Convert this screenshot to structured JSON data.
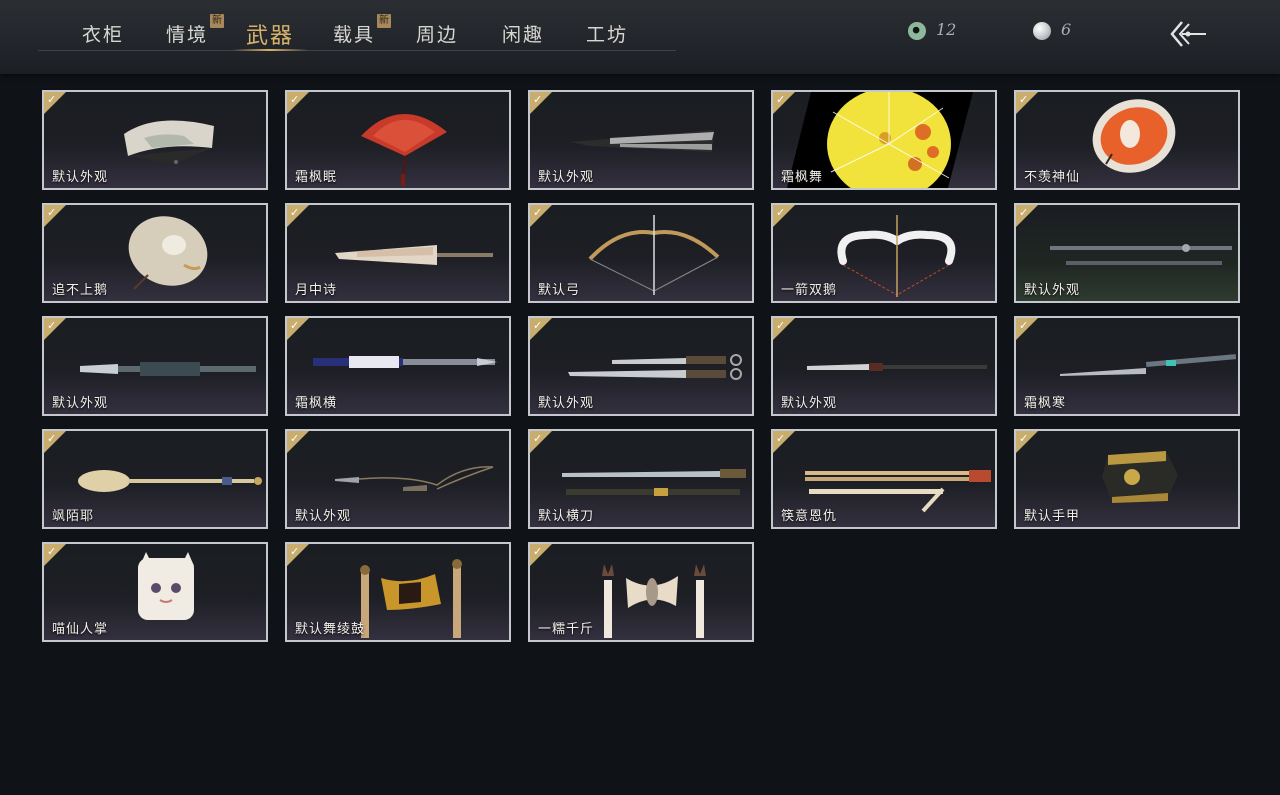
{
  "tabs": [
    {
      "label": "衣柜",
      "new": false
    },
    {
      "label": "情境",
      "new": true
    },
    {
      "label": "武器",
      "new": false,
      "active": true
    },
    {
      "label": "载具",
      "new": true
    },
    {
      "label": "周边",
      "new": false
    },
    {
      "label": "闲趣",
      "new": false
    },
    {
      "label": "工坊",
      "new": false
    }
  ],
  "new_badge": "新",
  "currencies": {
    "jade": {
      "icon": "jade-coin-icon",
      "amount": "12"
    },
    "pearl": {
      "icon": "pearl-icon",
      "amount": "6"
    }
  },
  "back_icon": "back-arrow-icon",
  "check_glyph": "✓",
  "items": [
    {
      "label": "默认外观",
      "icon": "folding-fan-icon"
    },
    {
      "label": "霜枫眠",
      "icon": "red-fan-icon"
    },
    {
      "label": "默认外观",
      "icon": "closed-fan-icon"
    },
    {
      "label": "霜枫舞",
      "icon": "yellow-umbrella-icon"
    },
    {
      "label": "不羡神仙",
      "icon": "orange-umbrella-icon"
    },
    {
      "label": "追不上鹅",
      "icon": "goose-umbrella-icon"
    },
    {
      "label": "月中诗",
      "icon": "closed-umbrella-icon"
    },
    {
      "label": "默认弓",
      "icon": "bow-icon"
    },
    {
      "label": "一箭双鹅",
      "icon": "goose-bow-icon"
    },
    {
      "label": "默认外观",
      "icon": "twin-spear-icon"
    },
    {
      "label": "默认外观",
      "icon": "lance-icon"
    },
    {
      "label": "霜枫横",
      "icon": "blue-lance-icon"
    },
    {
      "label": "默认外观",
      "icon": "twin-sword-icon"
    },
    {
      "label": "默认外观",
      "icon": "glaive-icon"
    },
    {
      "label": "霜枫寒",
      "icon": "jade-glaive-icon"
    },
    {
      "label": "飒陌耶",
      "icon": "spoon-staff-icon"
    },
    {
      "label": "默认外观",
      "icon": "rope-dart-icon"
    },
    {
      "label": "默认横刀",
      "icon": "saber-icon"
    },
    {
      "label": "筷意恩仇",
      "icon": "chopsticks-icon"
    },
    {
      "label": "默认手甲",
      "icon": "gauntlet-icon"
    },
    {
      "label": "喵仙人掌",
      "icon": "cat-paw-icon"
    },
    {
      "label": "默认舞绫鼓",
      "icon": "dance-drum-icon"
    },
    {
      "label": "一糯千斤",
      "icon": "mochi-drum-icon"
    }
  ],
  "colors": {
    "background": "#0f1318",
    "active_tab": "#d8b26a",
    "check_badge": "#c8ad6f",
    "card_border": "#c4c7cc"
  }
}
